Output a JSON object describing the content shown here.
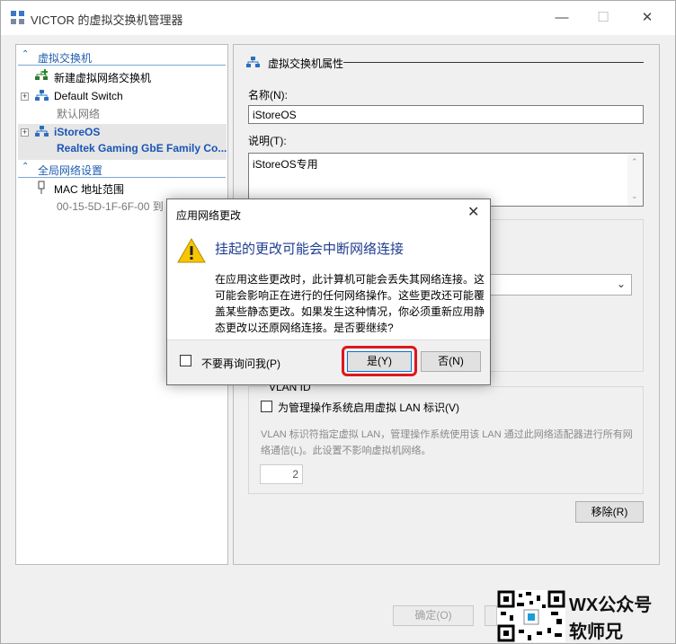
{
  "window": {
    "title": "VICTOR 的虚拟交换机管理器",
    "minimize": "—",
    "maximize": "☐",
    "close": "✕"
  },
  "left": {
    "section_switches": "虚拟交换机",
    "new_switch": "新建虚拟网络交换机",
    "default_switch": {
      "name": "Default Switch",
      "sub": "默认网络"
    },
    "istoreos": {
      "name": "iStoreOS",
      "sub": "Realtek Gaming GbE Family Co..."
    },
    "section_global": "全局网络设置",
    "mac": {
      "name": "MAC 地址范围",
      "sub": "00-15-5D-1F-6F-00 到"
    }
  },
  "right": {
    "group_title": "虚拟交换机属性",
    "name_label": "名称(N):",
    "name_value": "iStoreOS",
    "desc_label": "说明(T):",
    "desc_value": "iStoreOS专用",
    "vlan_title": "VLAN ID",
    "vlan_checkbox": "为管理操作系统启用虚拟 LAN 标识(V)",
    "vlan_desc": "VLAN 标识符指定虚拟 LAN，管理操作系统使用该 LAN 通过此网络适配器进行所有网络通信(L)。此设置不影响虚拟机网络。",
    "vlan_value": "2",
    "remove_button": "移除(R)",
    "ok_button": "确定(O)"
  },
  "dialog": {
    "title": "应用网络更改",
    "heading": "挂起的更改可能会中断网络连接",
    "body": "在应用这些更改时，此计算机可能会丢失其网络连接。这可能会影响正在进行的任何网络操作。这些更改还可能覆盖某些静态更改。如果发生这种情况，你必须重新应用静态更改以还原网络连接。是否要继续?",
    "dont_ask": "不要再询问我(P)",
    "yes": "是(Y)",
    "no": "否(N)"
  },
  "watermark": {
    "line1": "WX公众号",
    "line2": "软师兄"
  },
  "colors": {
    "accent": "#1f5eb0",
    "highlight": "#e0161c"
  }
}
